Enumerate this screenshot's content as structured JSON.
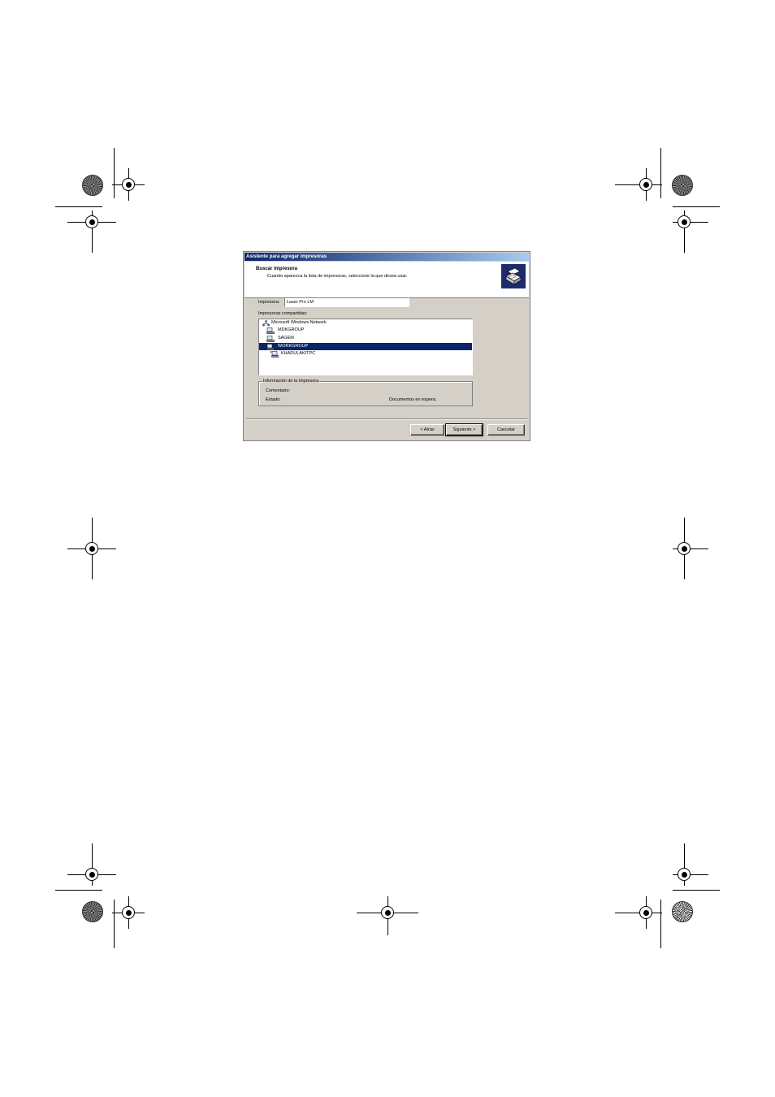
{
  "dialog": {
    "title": "Asistente para agregar impresoras",
    "header": {
      "title": "Buscar impresora",
      "subtitle": "Cuando aparezca la lista de impresoras, seleccione la que desea usar."
    },
    "printer_label": "Impresora:",
    "printer_value": "Laser Pro LM",
    "shared_label": "Impresoras compartidas:",
    "tree": [
      {
        "label": "Microsoft Windows Network",
        "icon": "network-icon",
        "selected": false
      },
      {
        "label": "MDKGROUP",
        "icon": "workgroup-icon",
        "selected": false
      },
      {
        "label": "SAGEM",
        "icon": "workgroup-icon",
        "selected": false
      },
      {
        "label": "WORKGROUP",
        "icon": "workgroup-icon",
        "selected": true
      },
      {
        "label": "KHADULAKITPC",
        "icon": "computer-icon",
        "selected": false
      }
    ],
    "info": {
      "legend": "Información de la impresora",
      "comment_label": "Comentario:",
      "status_label": "Estado:",
      "documents_label": "Documentos en espera:"
    },
    "buttons": {
      "back": "< Atrás",
      "next": "Siguiente >",
      "cancel": "Cancelar"
    },
    "colors": {
      "face": "#d4d0c8",
      "selection": "#0a246a",
      "titlebar_start": "#0a246a",
      "titlebar_end": "#a6caf0"
    }
  }
}
